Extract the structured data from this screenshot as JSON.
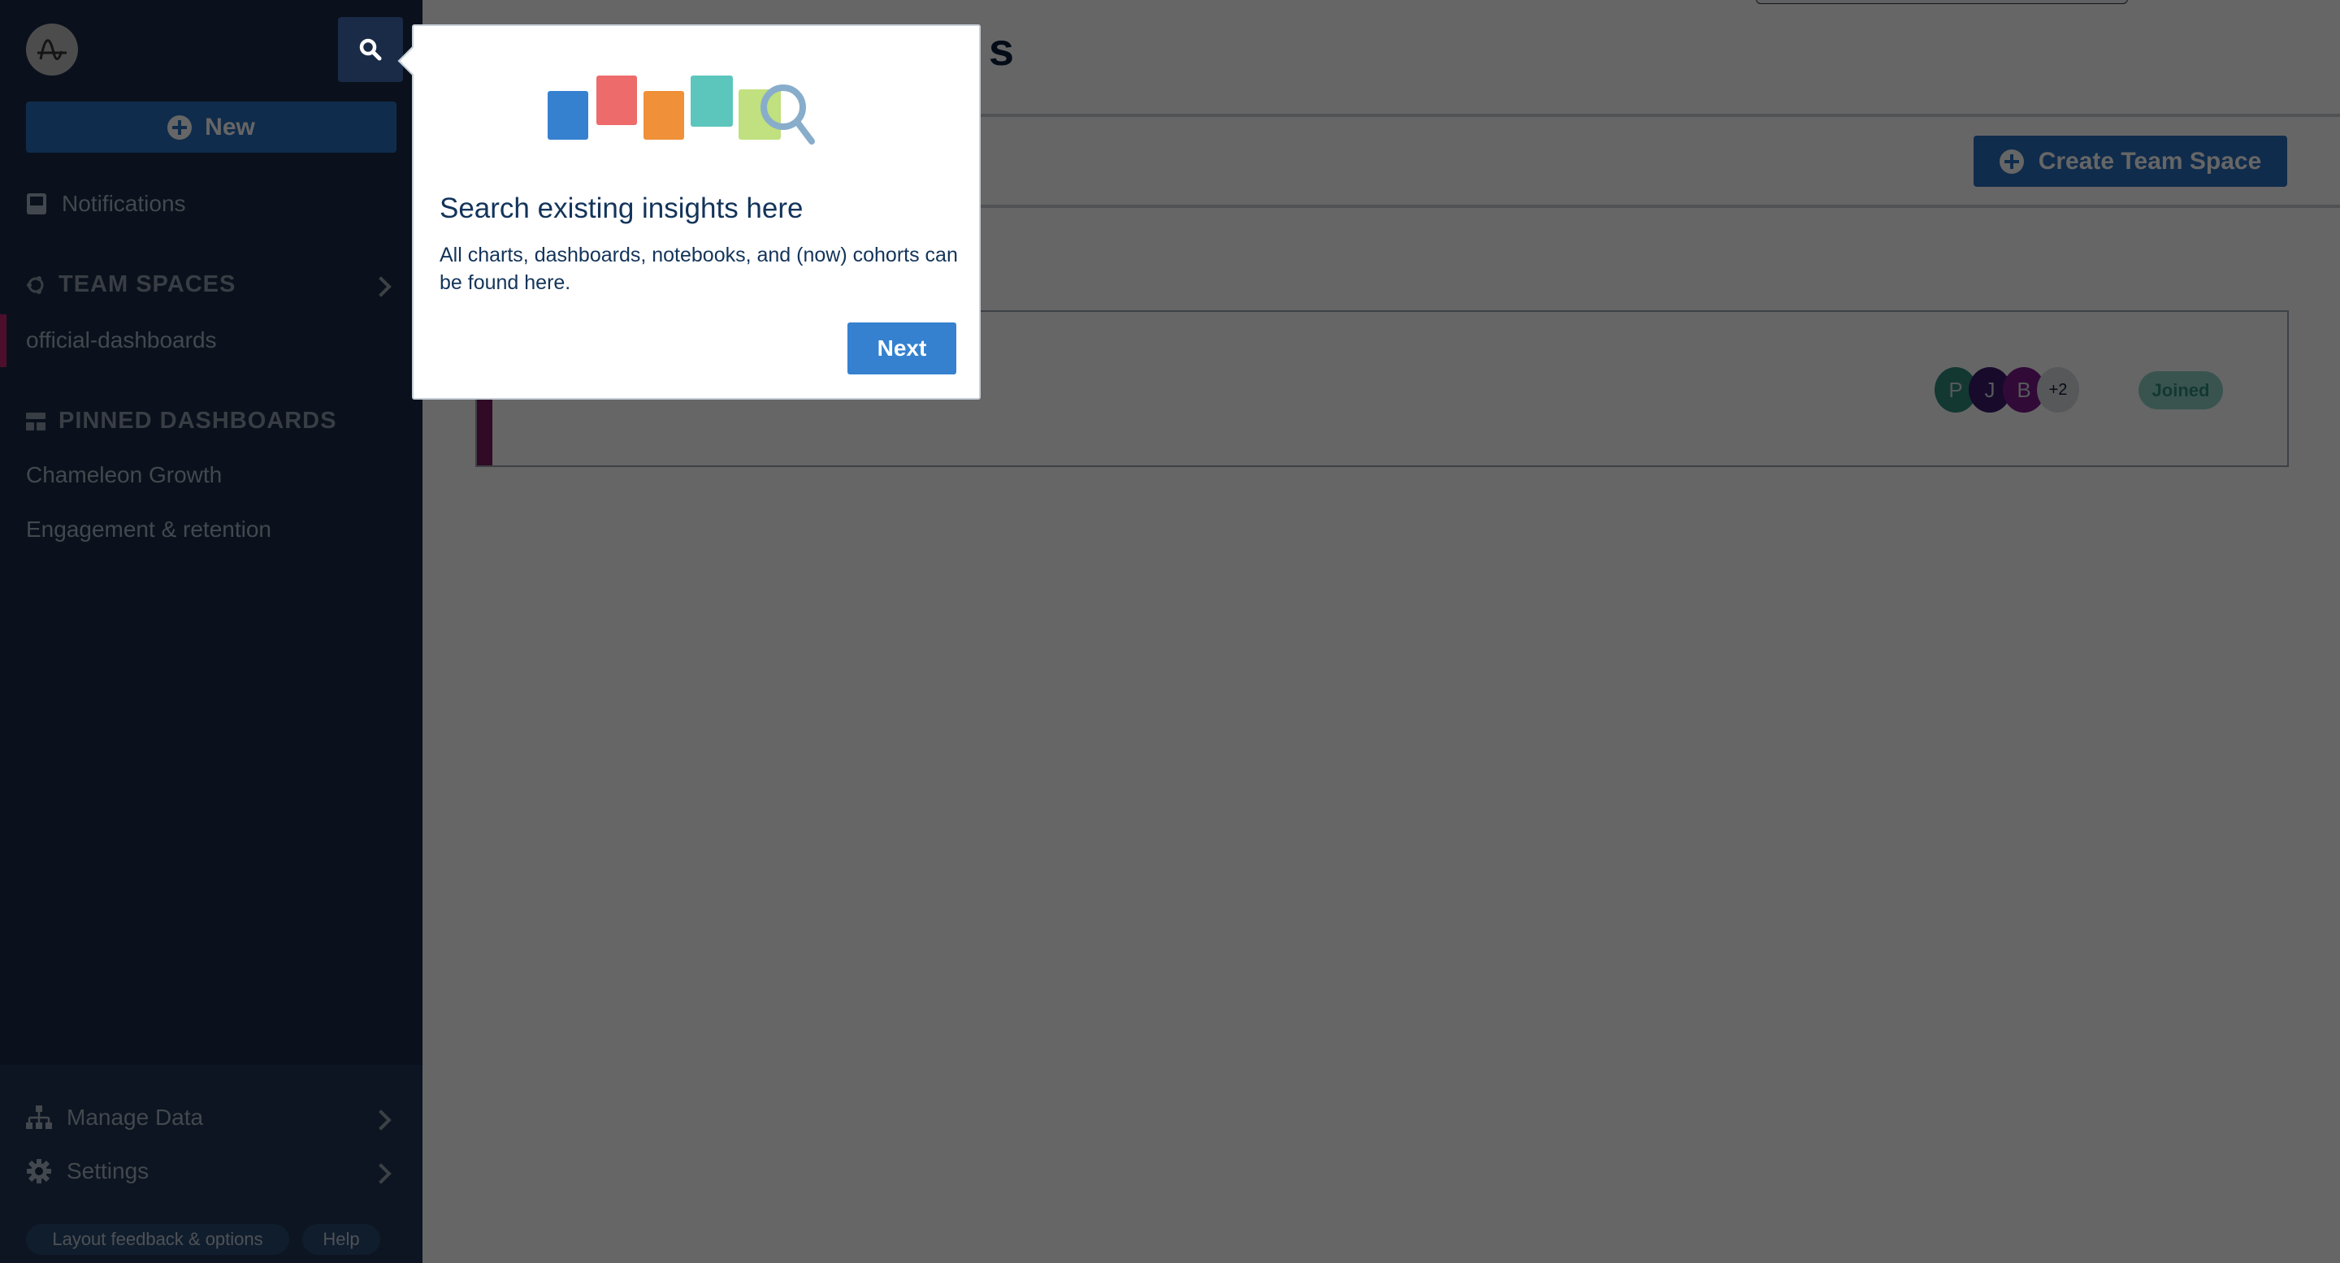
{
  "header": {
    "title_visible_fragment": "s",
    "create_button_label": "Create Team Space"
  },
  "sidebar": {
    "new_button_label": "New",
    "notifications_label": "Notifications",
    "team_spaces_heading": "TEAM SPACES",
    "team_spaces": [
      {
        "label": "official-dashboards",
        "active": true
      }
    ],
    "pinned_heading": "PINNED DASHBOARDS",
    "pinned": [
      {
        "label": "Chameleon Growth"
      },
      {
        "label": "Engagement & retention"
      }
    ],
    "bottom": {
      "manage_data_label": "Manage Data",
      "settings_label": "Settings",
      "layout_feedback_label": "Layout feedback & options",
      "help_label": "Help"
    }
  },
  "team_space_card": {
    "accent_color": "#7a1a5e",
    "members": [
      {
        "initial": "P",
        "color": "#2f8c7a"
      },
      {
        "initial": "J",
        "color": "#3b1a6b"
      },
      {
        "initial": "B",
        "color": "#7a1a8c"
      }
    ],
    "more_members": "+2",
    "status_badge": "Joined"
  },
  "tour_popup": {
    "title": "Search existing insights here",
    "body": "All charts, dashboards, notebooks, and (now) cohorts can be found here.",
    "next_label": "Next",
    "illustration_colors": [
      "#3581d0",
      "#ed6b6b",
      "#f09038",
      "#5cc6bd",
      "#c1e07f"
    ],
    "magnifier_color": "#88adcb"
  },
  "colors": {
    "sidebar_bg": "#1a2b47",
    "primary_button": "#2a6fbd",
    "popup_text": "#13345a"
  }
}
